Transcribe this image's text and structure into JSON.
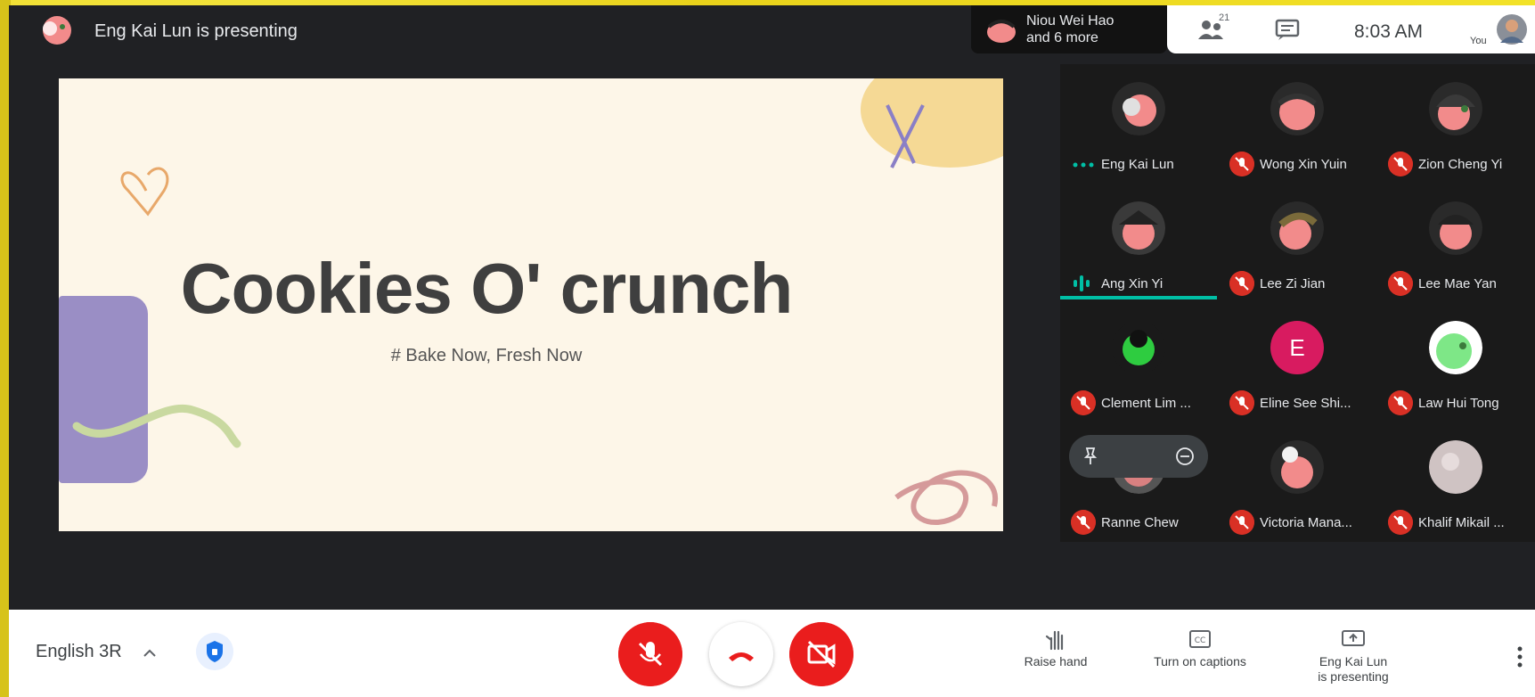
{
  "header": {
    "presenting_text": "Eng Kai Lun is presenting",
    "others_line1": "Niou Wei Hao",
    "others_line2": "and 6 more",
    "people_count": "21",
    "time": "8:03 AM",
    "you_label": "You"
  },
  "slide": {
    "title": "Cookies O' crunch",
    "subtitle": "# Bake Now, Fresh Now"
  },
  "participants": [
    {
      "name": "Eng Kai Lun",
      "state": "speaking-dots"
    },
    {
      "name": "Wong Xin Yuin",
      "state": "muted"
    },
    {
      "name": "Zion Cheng Yi",
      "state": "muted"
    },
    {
      "name": "Ang Xin Yi",
      "state": "speaking"
    },
    {
      "name": "Lee Zi Jian",
      "state": "muted"
    },
    {
      "name": "Lee Mae Yan",
      "state": "muted"
    },
    {
      "name": "Clement Lim ...",
      "state": "muted"
    },
    {
      "name": "Eline See Shi...",
      "state": "muted",
      "initial": "E"
    },
    {
      "name": "Law Hui Tong",
      "state": "muted"
    },
    {
      "name": "Ranne Chew",
      "state": "muted"
    },
    {
      "name": "Victoria Mana...",
      "state": "muted"
    },
    {
      "name": "Khalif Mikail ...",
      "state": "muted"
    }
  ],
  "controls": {
    "caption_language": "English 3R",
    "raise_hand": "Raise hand",
    "captions": "Turn on captions",
    "present_line1": "Eng Kai Lun",
    "present_line2": "is presenting"
  },
  "colors": {
    "accent_red": "#ea1d1d",
    "speaking_teal": "#00bfa5",
    "frame_yellow": "#f3e32a"
  }
}
